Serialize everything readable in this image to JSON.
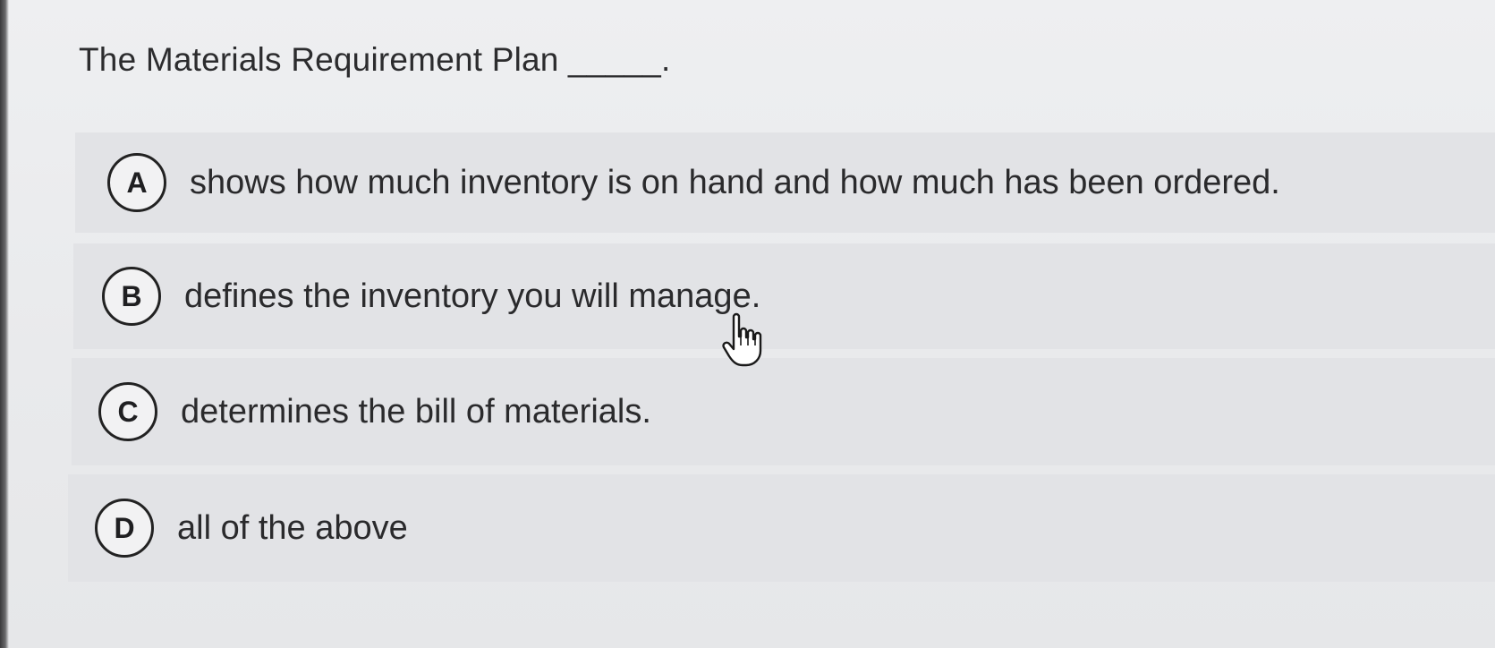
{
  "question": {
    "text": "The Materials Requirement Plan _____."
  },
  "options": [
    {
      "letter": "A",
      "text": "shows how much inventory is on hand and how much has been ordered."
    },
    {
      "letter": "B",
      "text": "defines the inventory you will manage."
    },
    {
      "letter": "C",
      "text": "determines the bill of materials."
    },
    {
      "letter": "D",
      "text": "all of the above"
    }
  ],
  "cursor": {
    "icon": "hand-pointer-icon"
  },
  "colors": {
    "background": "#eeeff1",
    "option_background": "#e2e3e6",
    "badge_border": "#222222",
    "text": "#2a2a2c"
  }
}
